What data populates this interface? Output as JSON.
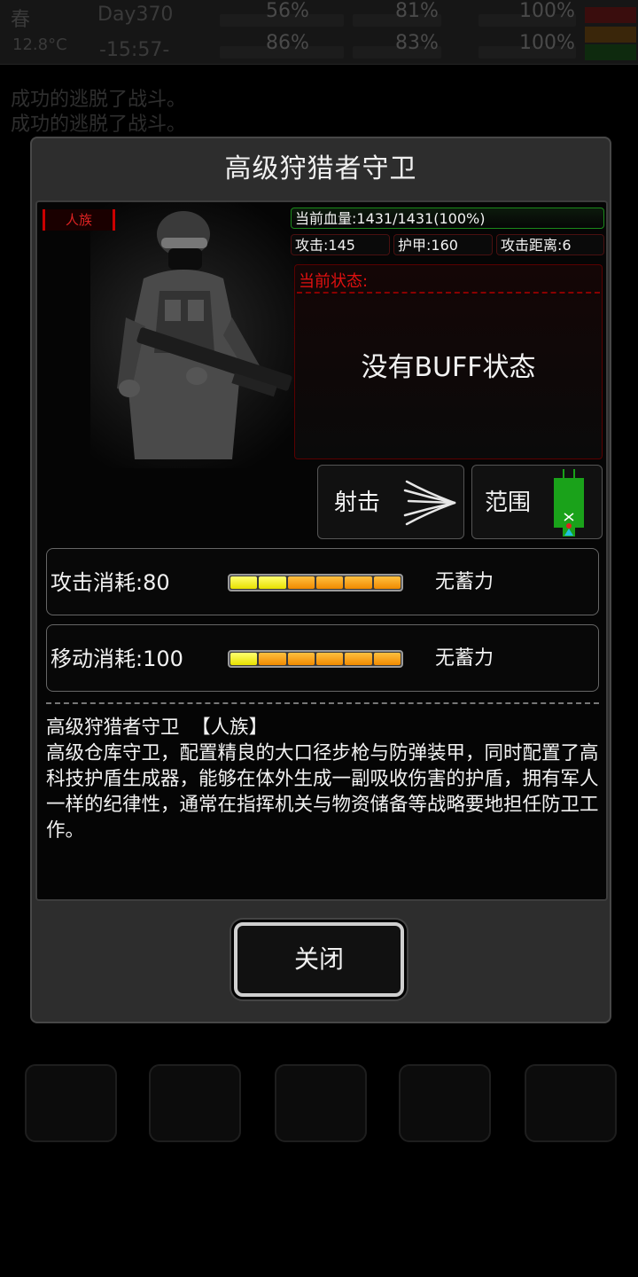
{
  "background": {
    "season": "春",
    "day": "Day370",
    "temperature": "12.8°C",
    "time": "-15:57-",
    "stats_top": [
      "56%",
      "81%",
      "100%"
    ],
    "stats_bottom": [
      "86%",
      "83%",
      "100%"
    ],
    "log_lines": [
      "成功的逃脱了战斗。",
      "成功的逃脱了战斗。"
    ]
  },
  "dialog": {
    "title": "高级狩猎者守卫",
    "race_tag": "人族",
    "hp": "当前血量:1431/1431(100%)",
    "attack": "攻击:145",
    "armor": "护甲:160",
    "attack_range": "攻击距离:6",
    "status_label": "当前状态:",
    "no_buff": "没有BUFF状态",
    "skill_shoot": "射击",
    "skill_range": "范围",
    "attack_cost": "攻击消耗:80",
    "move_cost": "移动消耗:100",
    "no_charge": "无蓄力",
    "desc_header": "高级狩猎者守卫  【人族】",
    "description": "高级仓库守卫，配置精良的大口径步枪与防弹装甲，同时配置了高科技护盾生成器，能够在体外生成一副吸收伤害的护盾，拥有军人一样的纪律性，通常在指挥机关与物资储备等战略要地担任防卫工作。",
    "close": "关闭",
    "attack_energy": {
      "filled_yellow": 2,
      "total": 6
    },
    "move_energy": {
      "filled_yellow": 1,
      "total": 6
    }
  },
  "colors": {
    "accent_red": "#e01010",
    "hp_green": "#1a8a1a",
    "energy_yellow": "#f0e000",
    "energy_orange": "#f08a00"
  }
}
